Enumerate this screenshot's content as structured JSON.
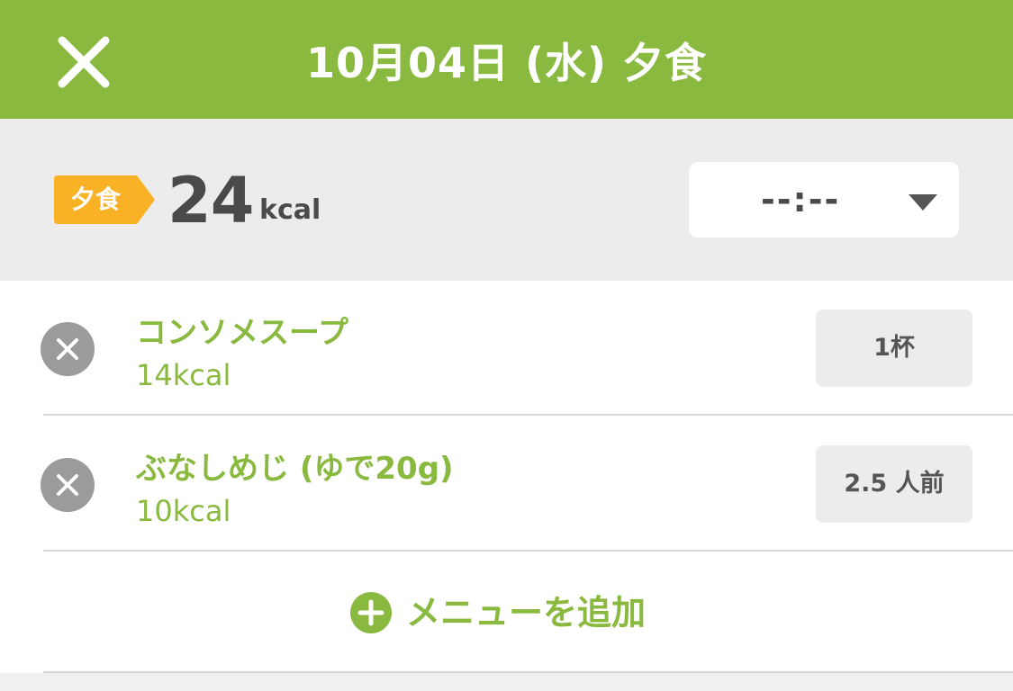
{
  "header": {
    "title": "10月04日 (水) 夕食",
    "close_icon": "close-icon",
    "color": "#8ab93f"
  },
  "summary": {
    "meal_tag": "夕食",
    "meal_tag_color": "#f9b125",
    "kcal_value": "24",
    "kcal_unit": "kcal",
    "time_value": "--:--",
    "time_dropdown_icon": "caret-down-icon"
  },
  "items": [
    {
      "name": "コンソメスープ",
      "kcal": "14kcal",
      "quantity": "1杯",
      "remove_icon": "remove-icon"
    },
    {
      "name": "ぶなしめじ (ゆで20g)",
      "kcal": "10kcal",
      "quantity": "2.5 人前",
      "remove_icon": "remove-icon"
    }
  ],
  "add_menu": {
    "label": "メニューを追加",
    "icon": "plus-circle-icon"
  },
  "colors": {
    "accent": "#8ab93f",
    "tag": "#f9b125",
    "text_dark": "#4a4a4a",
    "remove_gray": "#9b9b9b"
  }
}
